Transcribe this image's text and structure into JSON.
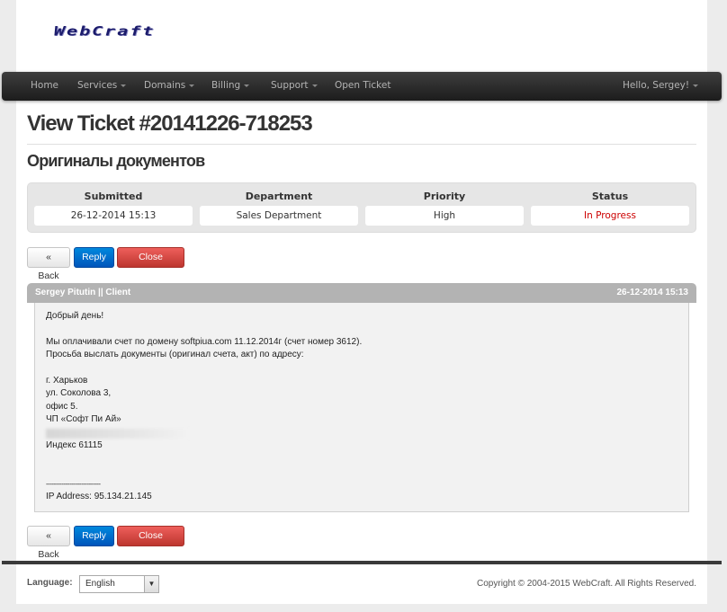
{
  "logo_text": "WebCraft",
  "nav": {
    "items": [
      {
        "label": "Home",
        "caret": false
      },
      {
        "label": "Services",
        "caret": true
      },
      {
        "label": "Domains",
        "caret": true
      },
      {
        "label": "Billing",
        "caret": true
      },
      {
        "label": "Support",
        "caret": true
      },
      {
        "label": "Open Ticket",
        "caret": false
      }
    ],
    "user_menu": "Hello, Sergey!"
  },
  "ticket": {
    "title": "View Ticket #20141226-718253",
    "subject": "Оригиналы документов",
    "info": [
      {
        "label": "Submitted",
        "value": "26-12-2014 15:13"
      },
      {
        "label": "Department",
        "value": "Sales Department"
      },
      {
        "label": "Priority",
        "value": "High"
      },
      {
        "label": "Status",
        "value": "In Progress"
      }
    ],
    "status_color": "#cc0000"
  },
  "buttons": {
    "back": "« Back",
    "reply": "Reply",
    "close": "Close Ticket"
  },
  "message": {
    "author": "Sergey Pitutin || Client",
    "date": "26-12-2014 15:13",
    "lines": [
      "Добрый день!",
      "",
      "Мы оплачивали счет по домену softpiua.com 11.12.2014г (счет номер 3612).",
      "Просьба выслать документы (оригинал счета, акт) по адресу:",
      "",
      "г. Харьков",
      "ул. Соколова 3,",
      "офис 5.",
      "ЧП «Софт Пи Ай»",
      "",
      "Индекс 61115",
      "",
      "",
      "----------------------------",
      "IP Address: 95.134.21.145"
    ]
  },
  "footer": {
    "language_label": "Language:",
    "language_value": "English",
    "copyright": "Copyright © 2004-2015 WebCraft. All Rights Reserved."
  },
  "colors": {
    "navbar": "#2a2a2a",
    "reply_button": "#0069cc",
    "close_button": "#d9534f",
    "message_header": "#b3b3b3"
  }
}
